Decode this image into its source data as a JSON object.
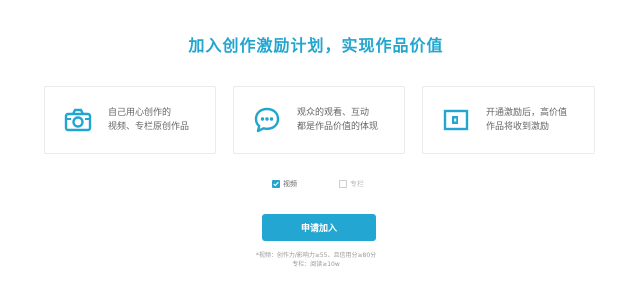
{
  "title": "加入创作激励计划，实现作品价值",
  "cards": [
    {
      "icon": "camera-icon",
      "line1": "自己用心创作的",
      "line2": "视频、专栏原创作品"
    },
    {
      "icon": "chat-bubble-icon",
      "line1": "观众的观看、互动",
      "line2": "都是作品价值的体现"
    },
    {
      "icon": "wallet-icon",
      "line1": "开通激励后，高价值",
      "line2": "作品将收到激励"
    }
  ],
  "options": [
    {
      "label": "视频",
      "checked": true
    },
    {
      "label": "专栏",
      "checked": false
    }
  ],
  "apply_button": "申请加入",
  "notes": [
    "*视频：创作力/影响力≥55、且信用分≥80分",
    "专栏：阅读≥10w"
  ],
  "colors": {
    "accent": "#22a6cf",
    "button": "#23a7d2",
    "border": "#e8eaec"
  }
}
